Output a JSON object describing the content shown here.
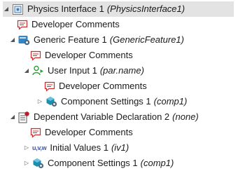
{
  "tree": {
    "physics_interface": {
      "label": "Physics Interface 1",
      "tag": "(PhysicsInterface1)"
    },
    "dev_comments_1": {
      "label": "Developer Comments"
    },
    "generic_feature": {
      "label": "Generic Feature 1",
      "tag": "(GenericFeature1)"
    },
    "dev_comments_2": {
      "label": "Developer Comments"
    },
    "user_input": {
      "label": "User Input 1",
      "tag": "(par.name)"
    },
    "dev_comments_3": {
      "label": "Developer Comments"
    },
    "component_settings_1": {
      "label": "Component Settings 1",
      "tag": "(comp1)"
    },
    "dependent_variable": {
      "label": "Dependent Variable Declaration 2",
      "tag": "(none)"
    },
    "dev_comments_4": {
      "label": "Developer Comments"
    },
    "initial_values": {
      "label": "Initial Values 1",
      "tag": "(iv1)",
      "icon_text": "u,v,w"
    },
    "component_settings_2": {
      "label": "Component Settings 1",
      "tag": "(comp1)"
    }
  },
  "colors": {
    "comment_red": "#cc2b2b",
    "feature_blue": "#2f86c8",
    "input_green": "#2e9e3a",
    "component_teal": "#1b8fb0",
    "dep_var_red": "#b0202e",
    "selection_bg": "#e3e3e3"
  },
  "icons": {
    "physics_interface": "physics-interface-icon",
    "developer_comments": "comment-icon",
    "generic_feature": "generic-feature-icon",
    "user_input": "user-input-icon",
    "component_settings": "component-settings-icon",
    "dependent_variable": "dependent-variable-icon",
    "initial_values": "initial-values-icon"
  }
}
